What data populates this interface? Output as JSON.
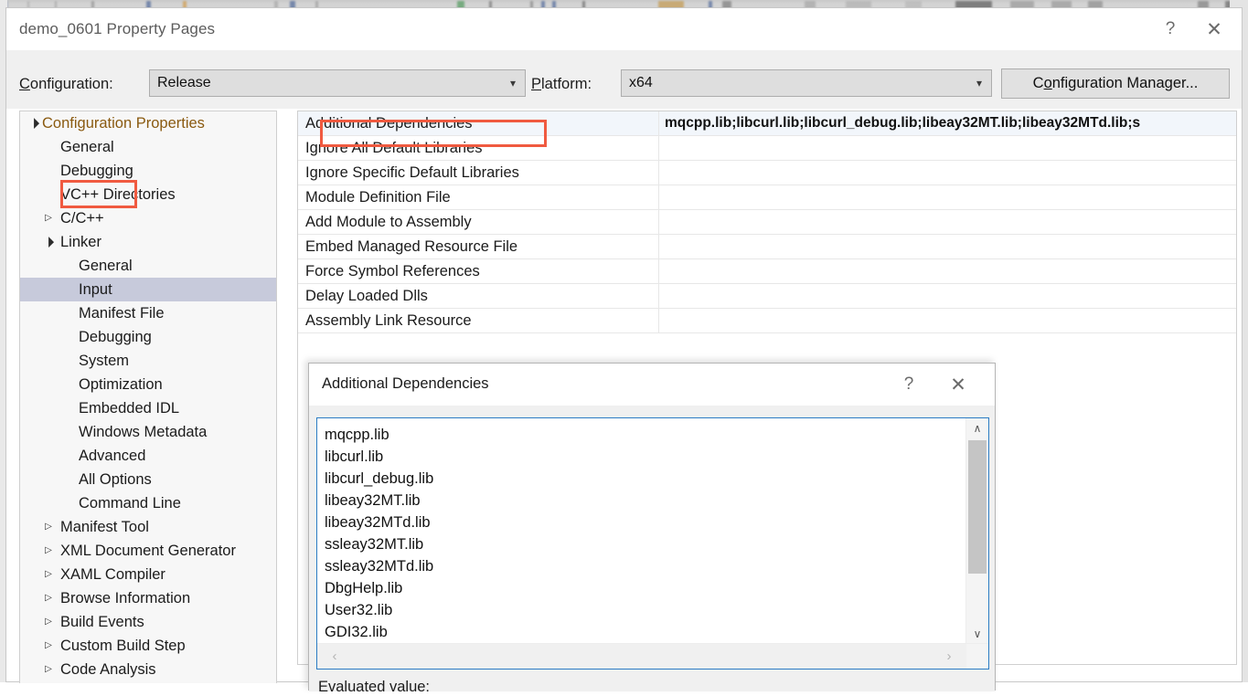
{
  "window": {
    "title": "demo_0601 Property Pages",
    "help_icon": "?",
    "help_icon_name": "help-icon",
    "close_icon": "✕",
    "close_icon_name": "close-icon"
  },
  "configbar": {
    "configuration_label": "Configuration:",
    "configuration_value": "Release",
    "platform_label": "Platform:",
    "platform_value": "x64",
    "configuration_manager_label": "Configuration Manager...",
    "chevron": "⌄"
  },
  "tree": {
    "nodes": [
      {
        "label": "Configuration Properties",
        "depth": 0,
        "arrow": "expanded",
        "selected": false
      },
      {
        "label": "General",
        "depth": 1,
        "arrow": "none",
        "selected": false
      },
      {
        "label": "Debugging",
        "depth": 1,
        "arrow": "none",
        "selected": false
      },
      {
        "label": "VC++ Directories",
        "depth": 1,
        "arrow": "none",
        "selected": false
      },
      {
        "label": "C/C++",
        "depth": 1,
        "arrow": "collapsed",
        "selected": false
      },
      {
        "label": "Linker",
        "depth": 1,
        "arrow": "expanded",
        "selected": false
      },
      {
        "label": "General",
        "depth": 2,
        "arrow": "none",
        "selected": false
      },
      {
        "label": "Input",
        "depth": 2,
        "arrow": "none",
        "selected": true
      },
      {
        "label": "Manifest File",
        "depth": 2,
        "arrow": "none",
        "selected": false
      },
      {
        "label": "Debugging",
        "depth": 2,
        "arrow": "none",
        "selected": false
      },
      {
        "label": "System",
        "depth": 2,
        "arrow": "none",
        "selected": false
      },
      {
        "label": "Optimization",
        "depth": 2,
        "arrow": "none",
        "selected": false
      },
      {
        "label": "Embedded IDL",
        "depth": 2,
        "arrow": "none",
        "selected": false
      },
      {
        "label": "Windows Metadata",
        "depth": 2,
        "arrow": "none",
        "selected": false
      },
      {
        "label": "Advanced",
        "depth": 2,
        "arrow": "none",
        "selected": false
      },
      {
        "label": "All Options",
        "depth": 2,
        "arrow": "none",
        "selected": false
      },
      {
        "label": "Command Line",
        "depth": 2,
        "arrow": "none",
        "selected": false
      },
      {
        "label": "Manifest Tool",
        "depth": 1,
        "arrow": "collapsed",
        "selected": false
      },
      {
        "label": "XML Document Generator",
        "depth": 1,
        "arrow": "collapsed",
        "selected": false
      },
      {
        "label": "XAML Compiler",
        "depth": 1,
        "arrow": "collapsed",
        "selected": false
      },
      {
        "label": "Browse Information",
        "depth": 1,
        "arrow": "collapsed",
        "selected": false
      },
      {
        "label": "Build Events",
        "depth": 1,
        "arrow": "collapsed",
        "selected": false
      },
      {
        "label": "Custom Build Step",
        "depth": 1,
        "arrow": "collapsed",
        "selected": false
      },
      {
        "label": "Code Analysis",
        "depth": 1,
        "arrow": "collapsed",
        "selected": false
      }
    ]
  },
  "grid": {
    "rows": [
      {
        "name": "Additional Dependencies",
        "value": "mqcpp.lib;libcurl.lib;libcurl_debug.lib;libeay32MT.lib;libeay32MTd.lib;s",
        "selected": true
      },
      {
        "name": "Ignore All Default Libraries",
        "value": "",
        "selected": false
      },
      {
        "name": "Ignore Specific Default Libraries",
        "value": "",
        "selected": false
      },
      {
        "name": "Module Definition File",
        "value": "",
        "selected": false
      },
      {
        "name": "Add Module to Assembly",
        "value": "",
        "selected": false
      },
      {
        "name": "Embed Managed Resource File",
        "value": "",
        "selected": false
      },
      {
        "name": "Force Symbol References",
        "value": "",
        "selected": false
      },
      {
        "name": "Delay Loaded Dlls",
        "value": "",
        "selected": false
      },
      {
        "name": "Assembly Link Resource",
        "value": "",
        "selected": false
      }
    ]
  },
  "dialog": {
    "title": "Additional Dependencies",
    "help_icon": "?",
    "close_icon": "✕",
    "libraries": [
      "mqcpp.lib",
      "libcurl.lib",
      "libcurl_debug.lib",
      "libeay32MT.lib",
      "libeay32MTd.lib",
      "ssleay32MT.lib",
      "ssleay32MTd.lib",
      "DbgHelp.lib",
      "User32.lib",
      "GDI32.lib"
    ],
    "evaluated_value_label": "Evaluated value:",
    "scroll_up_icon": "∧",
    "scroll_down_icon": "∨",
    "scroll_left_icon": "‹",
    "scroll_right_icon": "›"
  },
  "annotations": {
    "highlight_color": "#f05a40",
    "boxes": [
      {
        "target": "tree-item-input"
      },
      {
        "target": "grid-row-additional-dependencies"
      }
    ]
  }
}
